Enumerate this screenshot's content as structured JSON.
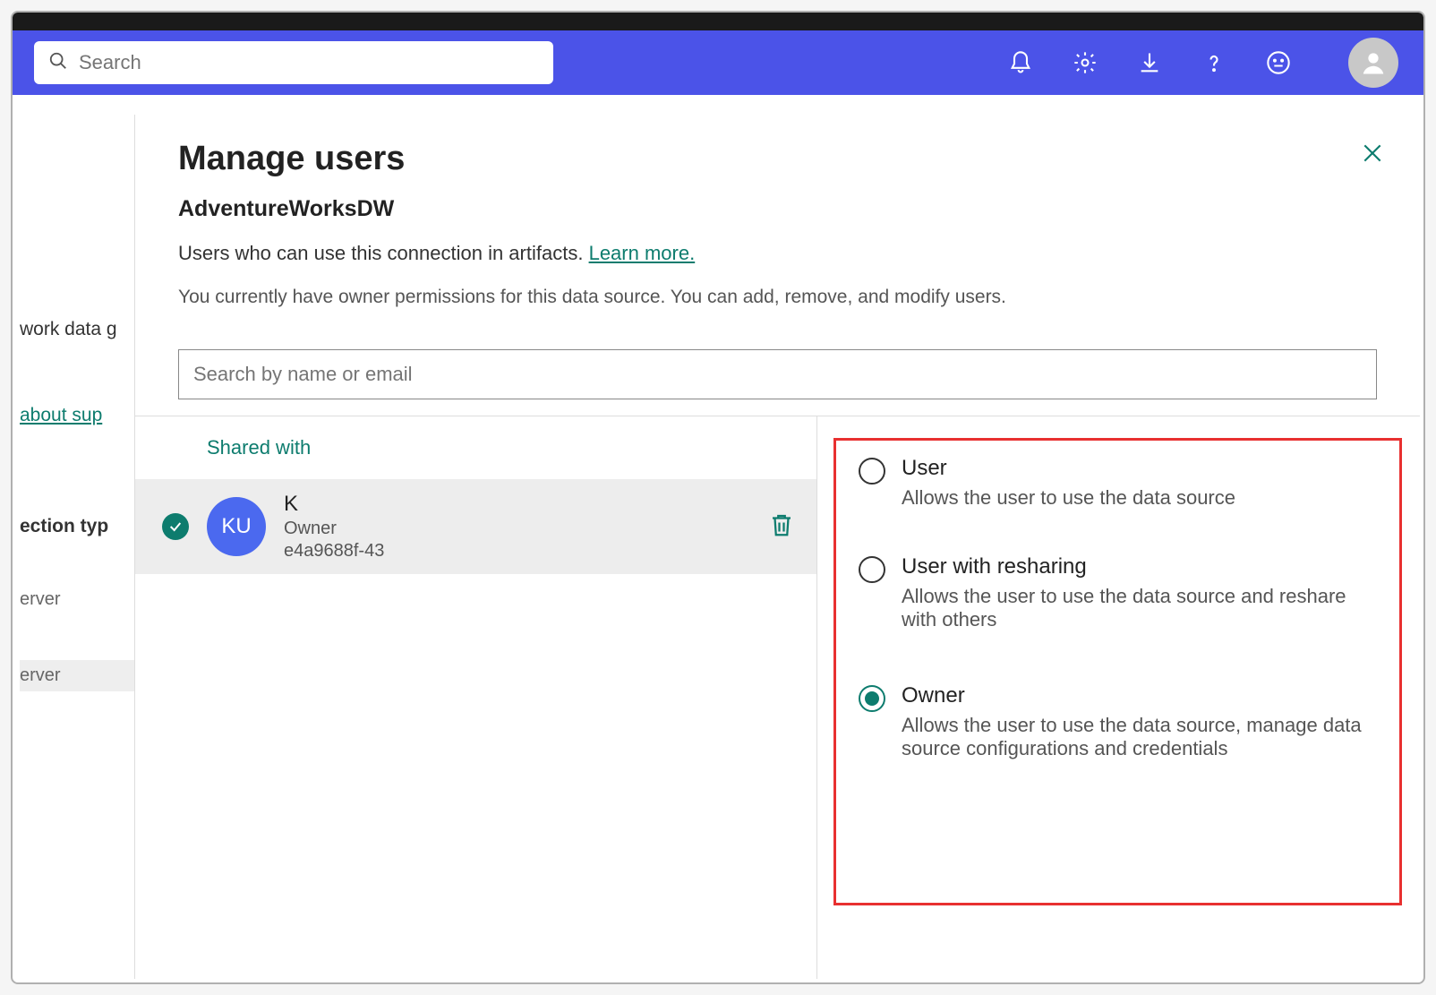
{
  "header": {
    "search_placeholder": "Search"
  },
  "background": {
    "gateway_text": "work data g",
    "about_link": "about sup",
    "connection_type": "ection typ",
    "server1": "erver",
    "server2": "erver"
  },
  "panel": {
    "title": "Manage users",
    "subtitle": "AdventureWorksDW",
    "description": "Users who can use this connection in artifacts.",
    "learn_more": "Learn more.",
    "permission_note": "You currently have owner permissions for this data source. You can add, remove, and modify users.",
    "search_placeholder": "Search by name or email",
    "shared_with_label": "Shared with"
  },
  "user": {
    "initials": "KU",
    "name": "K",
    "role": "Owner",
    "id": "e4a9688f-43"
  },
  "roles": [
    {
      "label": "User",
      "description": "Allows the user to use the data source",
      "selected": false
    },
    {
      "label": "User with resharing",
      "description": "Allows the user to use the data source and reshare with others",
      "selected": false
    },
    {
      "label": "Owner",
      "description": "Allows the user to use the data source, manage data source configurations and credentials",
      "selected": true
    }
  ]
}
